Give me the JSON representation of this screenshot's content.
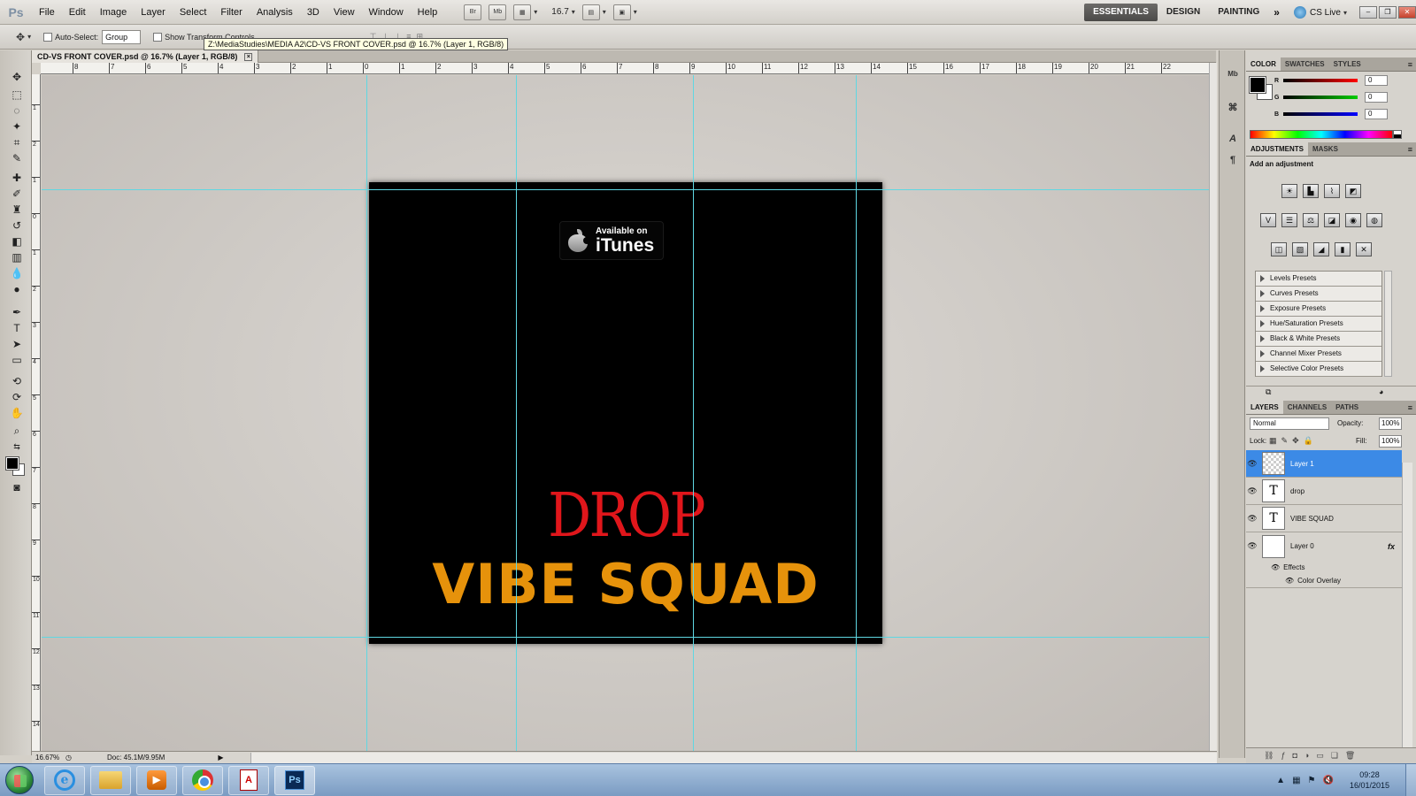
{
  "menubar": {
    "app_logo": "Ps",
    "items": [
      "File",
      "Edit",
      "Image",
      "Layer",
      "Select",
      "Filter",
      "Analysis",
      "3D",
      "View",
      "Window",
      "Help"
    ],
    "zoom": "16.7",
    "bridge_label": "Br",
    "minibridge_label": "Mb",
    "workspaces": [
      "ESSENTIALS",
      "DESIGN",
      "PAINTING"
    ],
    "more": "»",
    "cs_live": "CS Live"
  },
  "options": {
    "auto_select_label": "Auto-Select:",
    "auto_select_value": "Group",
    "transform_label": "Show Transform Controls",
    "tooltip": "Z:\\MediaStudies\\MEDIA A2\\CD-VS FRONT COVER.psd @ 16.7% (Layer 1, RGB/8)"
  },
  "document": {
    "tab_title": "CD-VS FRONT COVER.psd @ 16.7% (Layer 1, RGB/8)",
    "close_glyph": "×",
    "ruler_top_labels": [
      "8",
      "7",
      "6",
      "5",
      "4",
      "3",
      "2",
      "1",
      "0",
      "1",
      "2",
      "3",
      "4",
      "5",
      "6",
      "7",
      "8",
      "9",
      "10",
      "11",
      "12",
      "13",
      "14",
      "15",
      "16",
      "17",
      "18",
      "19",
      "20",
      "21",
      "22"
    ],
    "ruler_left_labels": [
      "1",
      "2",
      "1",
      "0",
      "1",
      "2",
      "3",
      "4",
      "5",
      "6",
      "7",
      "8",
      "9",
      "10",
      "11",
      "12",
      "13",
      "14",
      "15"
    ]
  },
  "artwork": {
    "badge_small": "Available on",
    "badge_big": "iTunes",
    "title_red": "DROP",
    "title_orange": "VIBE SQUAD"
  },
  "status": {
    "zoom": "16.67%",
    "doc_size": "Doc: 45.1M/9.95M"
  },
  "color_panel": {
    "tabs": [
      "COLOR",
      "SWATCHES",
      "STYLES"
    ],
    "channels": [
      {
        "label": "R",
        "value": "0",
        "color": "#e01a1a"
      },
      {
        "label": "G",
        "value": "0",
        "color": "#1ab81a"
      },
      {
        "label": "B",
        "value": "0",
        "color": "#1a1ae0"
      }
    ]
  },
  "adjustments_panel": {
    "tabs": [
      "ADJUSTMENTS",
      "MASKS"
    ],
    "title": "Add an adjustment",
    "presets": [
      "Levels Presets",
      "Curves Presets",
      "Exposure Presets",
      "Hue/Saturation Presets",
      "Black & White Presets",
      "Channel Mixer Presets",
      "Selective Color Presets"
    ]
  },
  "layers_panel": {
    "tabs": [
      "LAYERS",
      "CHANNELS",
      "PATHS"
    ],
    "blend_mode": "Normal",
    "opacity_label": "Opacity:",
    "opacity": "100%",
    "lock_label": "Lock:",
    "fill_label": "Fill:",
    "fill": "100%",
    "layers": [
      {
        "name": "Layer 1",
        "thumb": ""
      },
      {
        "name": "drop",
        "thumb": "T"
      },
      {
        "name": "VIBE SQUAD",
        "thumb": "T"
      },
      {
        "name": "Layer 0",
        "thumb": "",
        "fx": "fx"
      }
    ],
    "effects_label": "Effects",
    "color_overlay_label": "Color Overlay"
  },
  "taskbar": {
    "time": "09:28",
    "date": "16/01/2015",
    "ps_label": "Ps",
    "ie_label": "e",
    "media_label": "▶",
    "pdf_label": "A"
  },
  "colors": {
    "accent_selected": "#3c8ae6",
    "guide": "#5fd7e2",
    "drop_red": "#e0161b",
    "vibe_orange": "#e6920b"
  }
}
